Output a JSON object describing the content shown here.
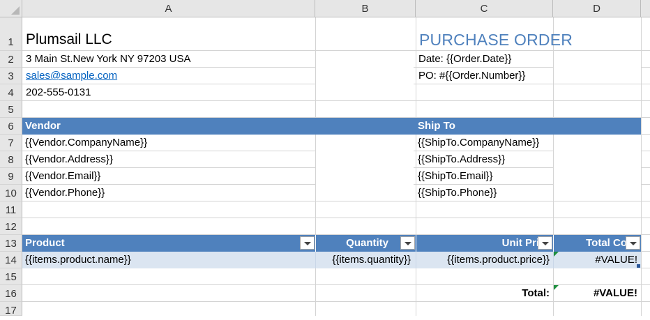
{
  "columns": [
    "A",
    "B",
    "C",
    "D"
  ],
  "rows": [
    "1",
    "2",
    "3",
    "4",
    "5",
    "6",
    "7",
    "8",
    "9",
    "10",
    "11",
    "12",
    "13",
    "14",
    "15",
    "16",
    "17"
  ],
  "company": {
    "name": "Plumsail LLC",
    "address": "3 Main St.New York NY 97203 USA",
    "email": "sales@sample.com ",
    "phone": "202-555-0131"
  },
  "order": {
    "title": "PURCHASE ORDER",
    "date": "Date: {{Order.Date}}",
    "po": "PO: #{{Order.Number}}"
  },
  "vendor": {
    "header": "Vendor",
    "company": "{{Vendor.CompanyName}}",
    "address": "{{Vendor.Address}}",
    "email": "{{Vendor.Email}}",
    "phone": "{{Vendor.Phone}}"
  },
  "ship_to": {
    "header": "Ship To",
    "company": "{{ShipTo.CompanyName}}",
    "address": "{{ShipTo.Address}}",
    "email": "{{ShipTo.Email}}",
    "phone": "{{ShipTo.Phone}}"
  },
  "table": {
    "headers": [
      "Product",
      "Quantity",
      "Unit Pri",
      "Total Co"
    ],
    "row": [
      "{{items.product.name}}",
      "{{items.quantity}}",
      "{{items.product.price}}",
      "#VALUE!"
    ]
  },
  "total": {
    "label": "Total:",
    "value": "#VALUE!"
  },
  "colors": {
    "header_band": "#4f81bd",
    "data_row": "#dbe5f1",
    "title": "#4f81bd",
    "link": "#0563c1"
  }
}
